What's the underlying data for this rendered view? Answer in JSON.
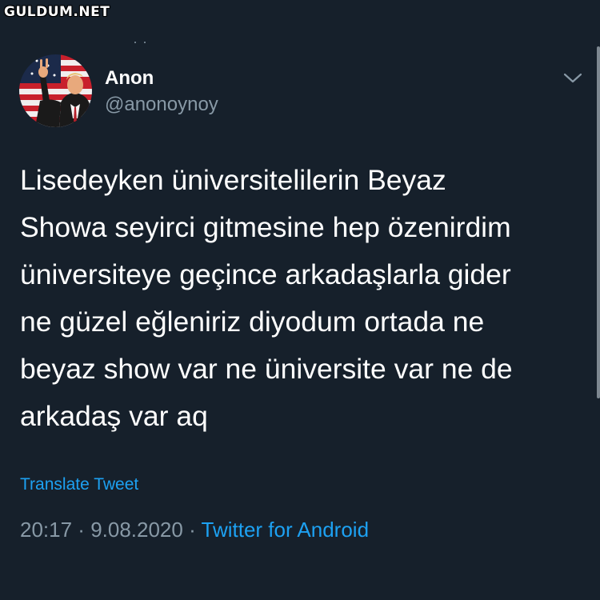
{
  "watermark": {
    "text": "GULDUM.NET"
  },
  "author": {
    "name": "Anon",
    "handle": "@anonoynoy"
  },
  "tweet": {
    "text": "Lisedeyken üniversitelilerin Beyaz\nShowa seyirci gitmesine hep özenirdim\nüniversiteye geçince arkadaşlarla gider\nne güzel eğleniriz diyodum ortada ne\nbeyaz show var ne üniversite var ne de\narkadaş var aq",
    "translate_label": "Translate Tweet",
    "time": "20:17",
    "date": "9.08.2020",
    "separator": " · ",
    "source": "Twitter for Android"
  },
  "icons": {
    "menu": "chevron-down-icon",
    "avatar": "avatar-image"
  },
  "colors": {
    "background": "#16202b",
    "text": "#ffffff",
    "secondary": "#8899a6",
    "link": "#1da1f2"
  }
}
